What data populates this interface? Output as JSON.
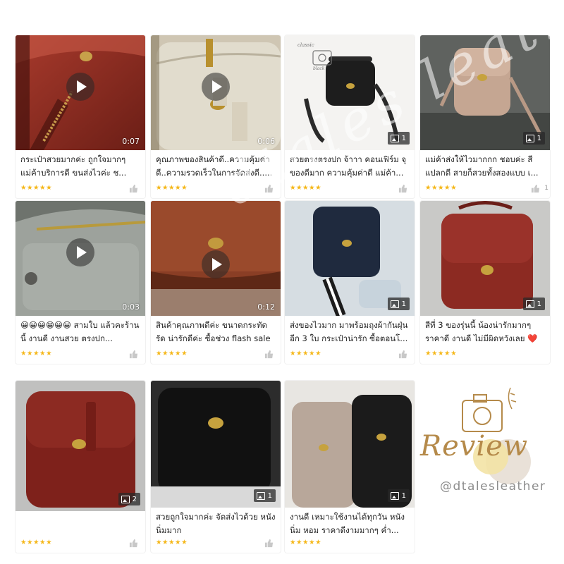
{
  "brand": {
    "accent_star": "#f5b718",
    "star_glyphs": "★★★★★",
    "watermark": "dtales leather",
    "review_word": "Review",
    "handle": "@dtalesleather",
    "product_stamp_line1": "classic",
    "product_stamp_line2": "black"
  },
  "cards": [
    {
      "text": "กระเป๋าสวยมากค่ะ ถูกใจมากๆ แม่ค้าบริการดี ขนส่งไวค่ะ ช...",
      "media": "video",
      "duration": "0:07",
      "stars": "★★★★★"
    },
    {
      "text": "คุณภาพของสินค้าดี..ความคุ้มค่า ดี..ความรวดเร็วในการจัดส่งดี.....",
      "media": "video",
      "duration": "0:06",
      "stars": "★★★★★"
    },
    {
      "text": "สวยตรงตรงปก จ้าาา คอนเฟิร์ม จุ ของดีมาก ความคุ้มค่าดี แม่ค้า...",
      "media": "image",
      "count": "1",
      "stars": "★★★★★"
    },
    {
      "text": "แม่ค้าส่งให้ไวมากกก ชอบค่ะ สี แปลกดี สายก็สวยทั้งสองแบบ เ...",
      "media": "image",
      "count": "1",
      "stars": "★★★★★",
      "likes": "1"
    },
    {
      "text": "😀😀😀😁😀😀 สามใบ แล้วคะร้านนี้ งานดี งานสวย ตรงปก...",
      "media": "video",
      "duration": "0:03",
      "stars": "★★★★★"
    },
    {
      "text": "สินค้าคุณภาพดีค่ะ ขนาดกระทัดรัด น่ารักดีค่ะ ซื้อช่วง flash sale แล...",
      "media": "video",
      "duration": "0:12",
      "stars": "★★★★★"
    },
    {
      "text": "ส่งของไวมาก มาพร้อมถุงผ้ากันฝุ่น อีก 3 ใบ กระเป๋าน่ารัก ซื้อตอนโ...",
      "media": "image",
      "count": "1",
      "stars": "★★★★★"
    },
    {
      "text": "สีที่ 3 ของรุ่นนี้ น้องน่ารักมากๆ ราคาดี งานดี ไม่มีผิดหวังเลย ❤️",
      "media": "image",
      "count": "1",
      "stars": "★★★★★"
    },
    {
      "text": "",
      "media": "image",
      "count": "2",
      "stars": "★★★★★"
    },
    {
      "text": "สวยถูกใจมากค่ะ จัดส่งไวด้วย หนัง นิ่มมาก",
      "media": "image",
      "count": "1",
      "stars": "★★★★★"
    },
    {
      "text": "งานดี เหมาะใช้งานได้ทุกวัน หนัง นิ่ม หอม ราคาดีงามมากๆ ค่ำ...",
      "media": "image",
      "count": "1",
      "stars": "★★★★★"
    }
  ]
}
